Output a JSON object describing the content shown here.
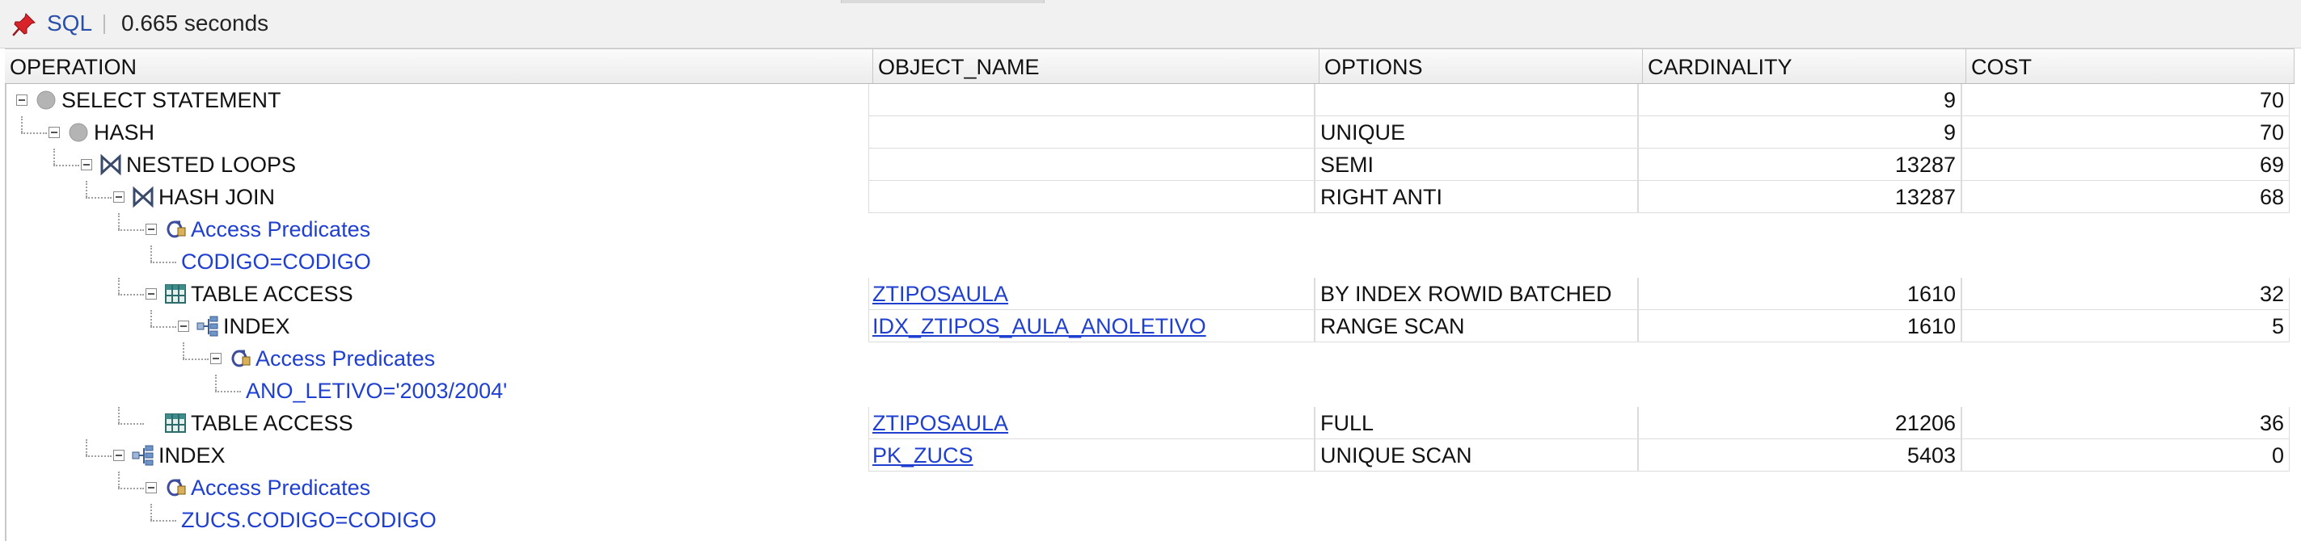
{
  "toolbar": {
    "pin_icon": "pushpin-icon",
    "sql_label": "SQL",
    "timing": "0.665 seconds"
  },
  "columns": {
    "operation": "OPERATION",
    "object_name": "OBJECT_NAME",
    "options": "OPTIONS",
    "cardinality": "CARDINALITY",
    "cost": "COST"
  },
  "rows": [
    {
      "operation": "SELECT STATEMENT",
      "object_name": "",
      "options": "",
      "cardinality": "9",
      "cost": "70",
      "icon": "statement-circle-icon"
    },
    {
      "operation": "HASH",
      "object_name": "",
      "options": "UNIQUE",
      "cardinality": "9",
      "cost": "70",
      "icon": "hash-circle-icon"
    },
    {
      "operation": "NESTED LOOPS",
      "object_name": "",
      "options": "SEMI",
      "cardinality": "13287",
      "cost": "69",
      "icon": "join-bowtie-icon"
    },
    {
      "operation": "HASH JOIN",
      "object_name": "",
      "options": "RIGHT ANTI",
      "cardinality": "13287",
      "cost": "68",
      "icon": "join-bowtie-icon"
    },
    {
      "operation": "Access Predicates",
      "icon": "filter-predicate-icon"
    },
    {
      "operation": "CODIGO=CODIGO"
    },
    {
      "operation": "TABLE ACCESS",
      "object_name": "ZTIPOSAULA",
      "options": "BY INDEX ROWID BATCHED",
      "cardinality": "1610",
      "cost": "32",
      "icon": "table-grid-icon"
    },
    {
      "operation": "INDEX",
      "object_name": "IDX_ZTIPOS_AULA_ANOLETIVO",
      "options": "RANGE SCAN",
      "cardinality": "1610",
      "cost": "5",
      "icon": "index-tree-icon"
    },
    {
      "operation": "Access Predicates",
      "icon": "filter-predicate-icon"
    },
    {
      "operation": "ANO_LETIVO='2003/2004'"
    },
    {
      "operation": "TABLE ACCESS",
      "object_name": "ZTIPOSAULA",
      "options": "FULL",
      "cardinality": "21206",
      "cost": "36",
      "icon": "table-grid-icon"
    },
    {
      "operation": "INDEX",
      "object_name": "PK_ZUCS",
      "options": "UNIQUE SCAN",
      "cardinality": "5403",
      "cost": "0",
      "icon": "index-tree-icon"
    },
    {
      "operation": "Access Predicates",
      "icon": "filter-predicate-icon"
    },
    {
      "operation": "ZUCS.CODIGO=CODIGO"
    }
  ],
  "colors": {
    "link": "#1f3fd0",
    "sql_label": "#2a4fa8",
    "header_bg": "#ececec",
    "grid_line": "#dcdcdc"
  }
}
